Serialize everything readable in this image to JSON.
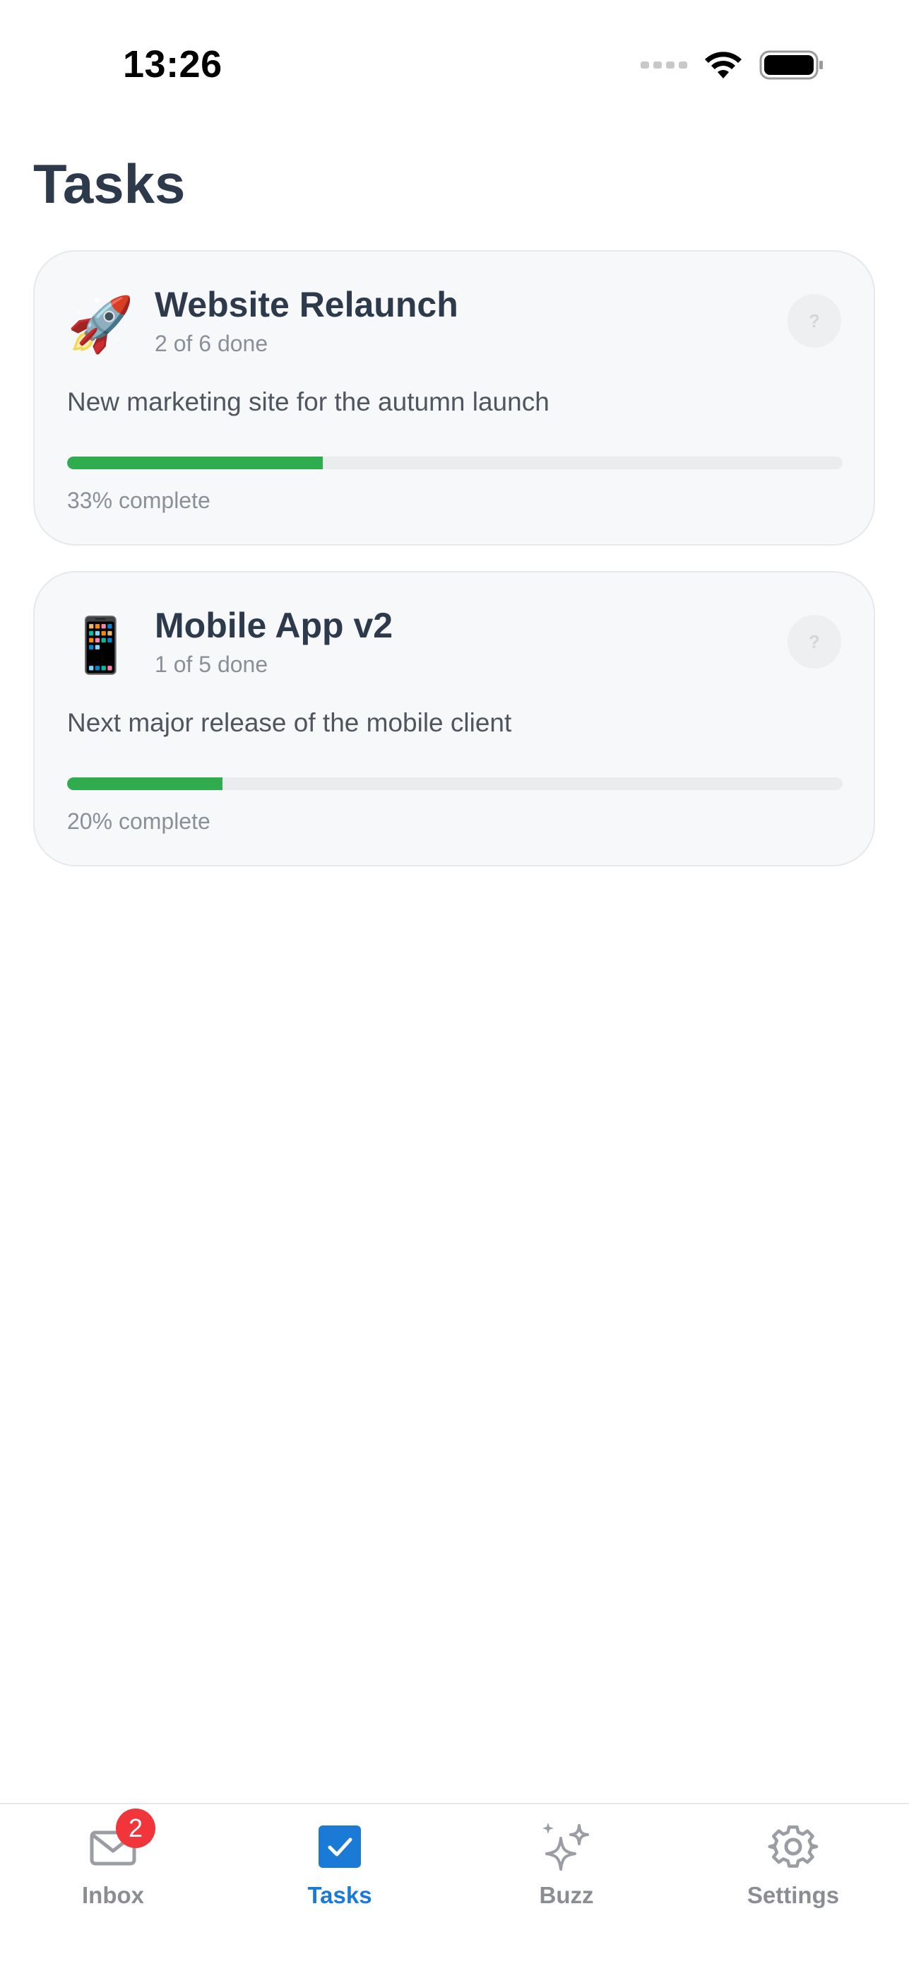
{
  "status_bar": {
    "time": "13:26"
  },
  "page": {
    "title": "Tasks"
  },
  "projects": [
    {
      "emoji": "🚀",
      "emoji_name": "rocket-icon",
      "title": "Website Relaunch",
      "progress_text": "2 of 6 done",
      "description": "New marketing site for the autumn launch",
      "percent": 33,
      "percent_label": "33% complete",
      "help": "?"
    },
    {
      "emoji": "📱",
      "emoji_name": "mobile-phone-icon",
      "title": "Mobile App v2",
      "progress_text": "1 of 5 done",
      "description": "Next major release of the mobile client",
      "percent": 20,
      "percent_label": "20% complete",
      "help": "?"
    }
  ],
  "tab_bar": {
    "tabs": [
      {
        "label": "Inbox",
        "icon": "mail-icon",
        "badge": "2",
        "active": false
      },
      {
        "label": "Tasks",
        "icon": "checkbox-icon",
        "active": true
      },
      {
        "label": "Buzz",
        "icon": "sparkles-icon",
        "active": false
      },
      {
        "label": "Settings",
        "icon": "gear-icon",
        "active": false
      }
    ]
  },
  "colors": {
    "accent": "#1a7ad6",
    "progress": "#2fac4e",
    "badge": "#f0363b",
    "title": "#2c3a4b"
  }
}
